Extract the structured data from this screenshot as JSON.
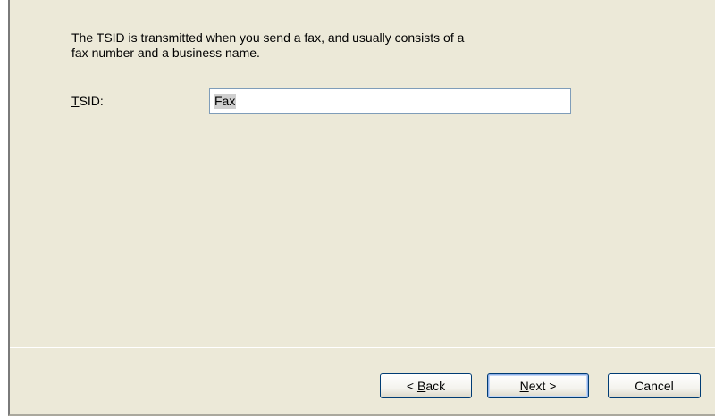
{
  "description": {
    "line1": "The TSID is transmitted when you send a fax, and usually consists of a",
    "line2": "fax number and a business name."
  },
  "tsid_field": {
    "label_accel": "T",
    "label_rest": "SID:",
    "value": "Fax"
  },
  "buttons": {
    "back_prefix": "< ",
    "back_accel": "B",
    "back_rest": "ack",
    "next_accel": "N",
    "next_rest": "ext >",
    "cancel": "Cancel"
  }
}
